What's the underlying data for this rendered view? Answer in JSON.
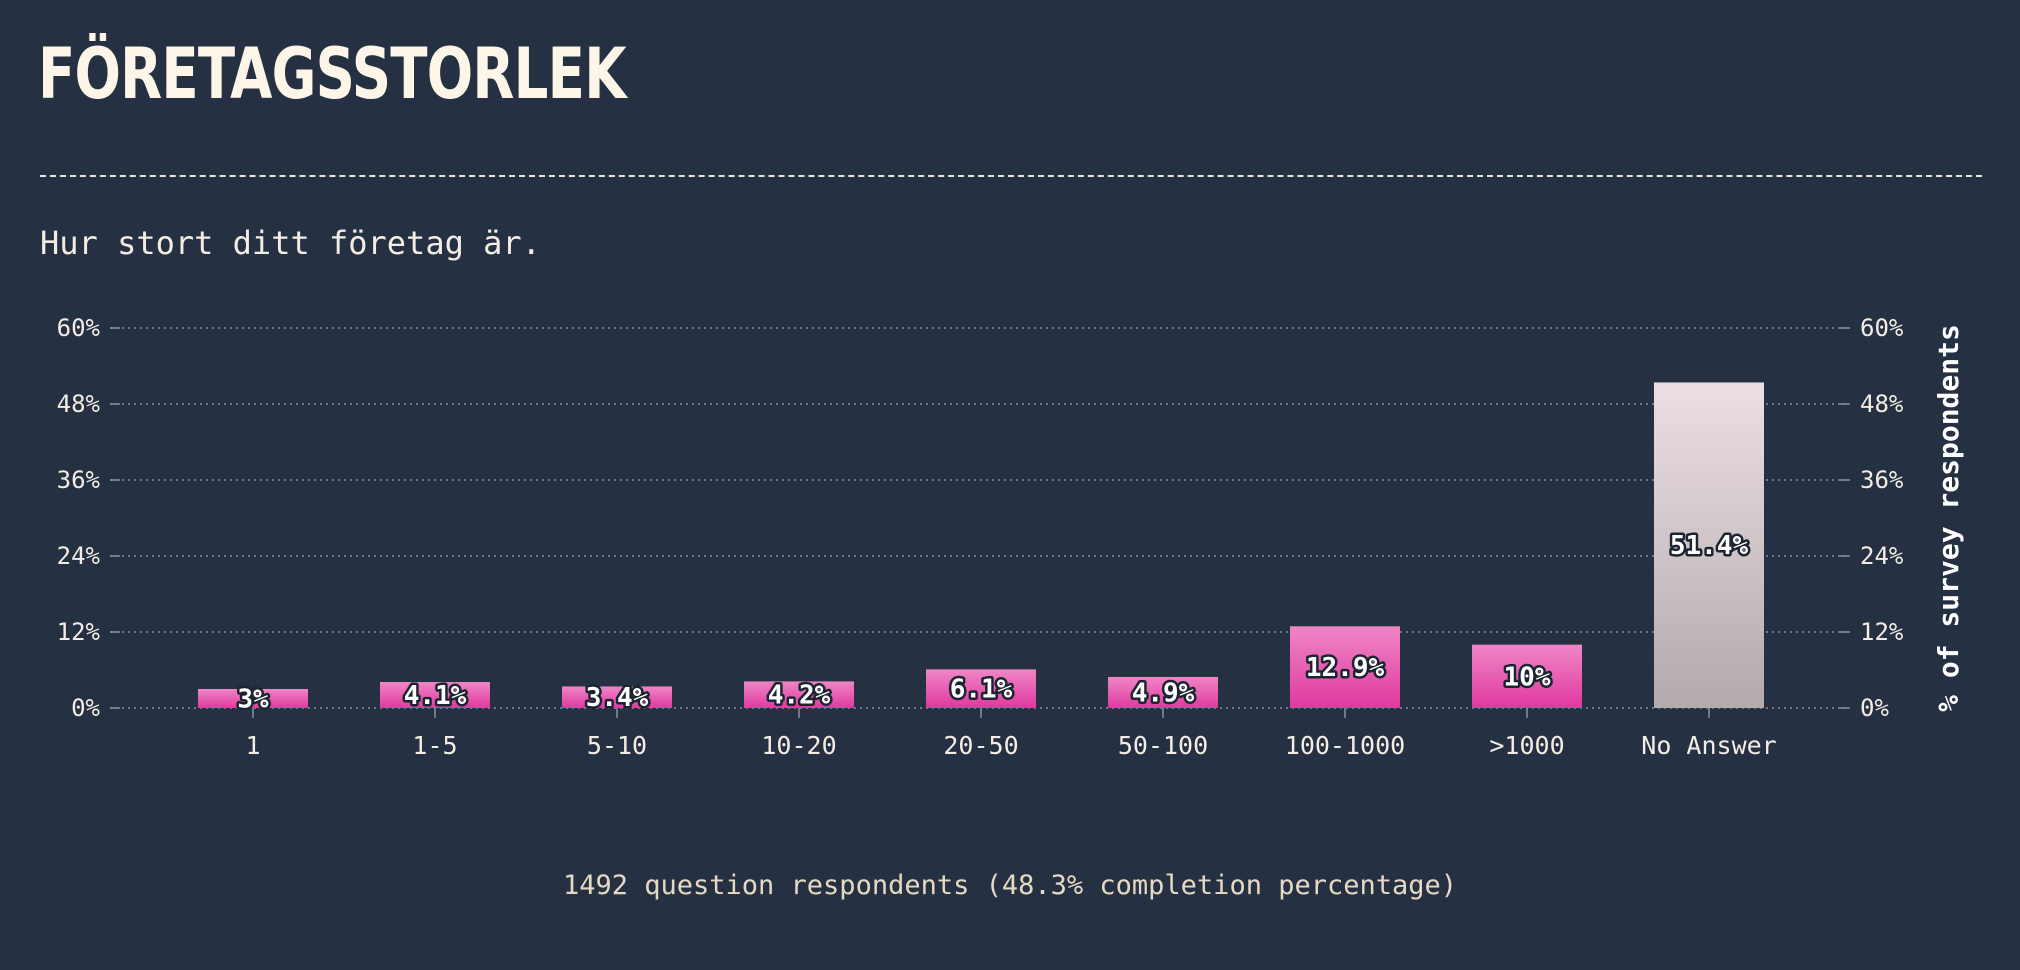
{
  "page": {
    "title": "FÖRETAGSSTORLEK",
    "subtitle": "Hur stort ditt företag är.",
    "footer": "1492 question respondents (48.3% completion percentage)"
  },
  "colors": {
    "background": "#253142",
    "bar_fill_top": "#ef86c6",
    "bar_fill_bottom": "#e0399f",
    "no_answer_fill_top": "#ecdfe4",
    "no_answer_fill_bottom": "#b3aaab",
    "grid": "#8a93a0",
    "text": "#f3ede4"
  },
  "chart_data": {
    "type": "bar",
    "title": "",
    "xlabel": "",
    "ylabel": "% of survey respondents",
    "ylim": [
      0,
      60
    ],
    "y_ticks": [
      0,
      12,
      24,
      36,
      48,
      60
    ],
    "y_tick_labels": [
      "0%",
      "12%",
      "24%",
      "36%",
      "48%",
      "60%"
    ],
    "grid": true,
    "dual_y_axis": true,
    "categories": [
      "1",
      "1-5",
      "5-10",
      "10-20",
      "20-50",
      "50-100",
      "100-1000",
      ">1000",
      "No Answer"
    ],
    "values": [
      3,
      4.1,
      3.4,
      4.2,
      6.1,
      4.9,
      12.9,
      10,
      51.4
    ],
    "value_labels": [
      "3%",
      "4.1%",
      "3.4%",
      "4.2%",
      "6.1%",
      "4.9%",
      "12.9%",
      "10%",
      "51.4%"
    ],
    "highlighted_category": "No Answer"
  }
}
